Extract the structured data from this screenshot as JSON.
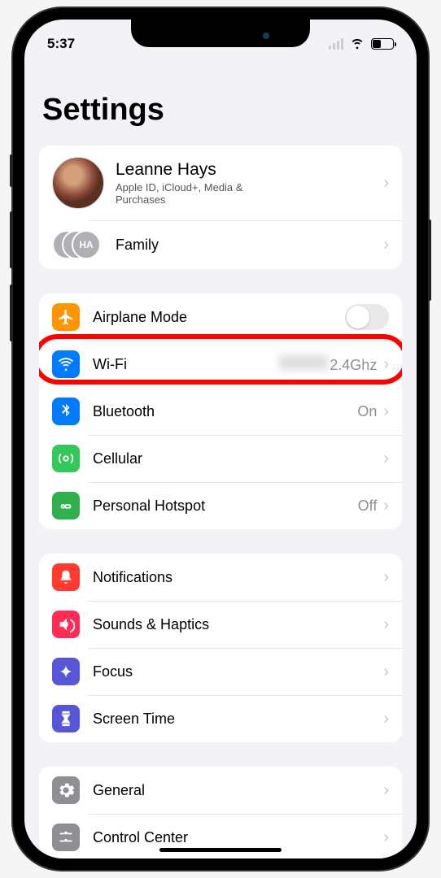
{
  "status": {
    "time": "5:37"
  },
  "page": {
    "title": "Settings"
  },
  "profile": {
    "name": "Leanne Hays",
    "subtitle": "Apple ID, iCloud+, Media & Purchases",
    "family_label": "Family",
    "family_badge": "HA"
  },
  "connectivity": {
    "airplane": {
      "label": "Airplane Mode"
    },
    "wifi": {
      "label": "Wi-Fi",
      "value_suffix": "2.4Ghz"
    },
    "bluetooth": {
      "label": "Bluetooth",
      "value": "On"
    },
    "cellular": {
      "label": "Cellular"
    },
    "hotspot": {
      "label": "Personal Hotspot",
      "value": "Off"
    }
  },
  "notifications_group": {
    "notifications": {
      "label": "Notifications"
    },
    "sounds": {
      "label": "Sounds & Haptics"
    },
    "focus": {
      "label": "Focus"
    },
    "screentime": {
      "label": "Screen Time"
    }
  },
  "general_group": {
    "general": {
      "label": "General"
    },
    "control_center": {
      "label": "Control Center"
    }
  }
}
